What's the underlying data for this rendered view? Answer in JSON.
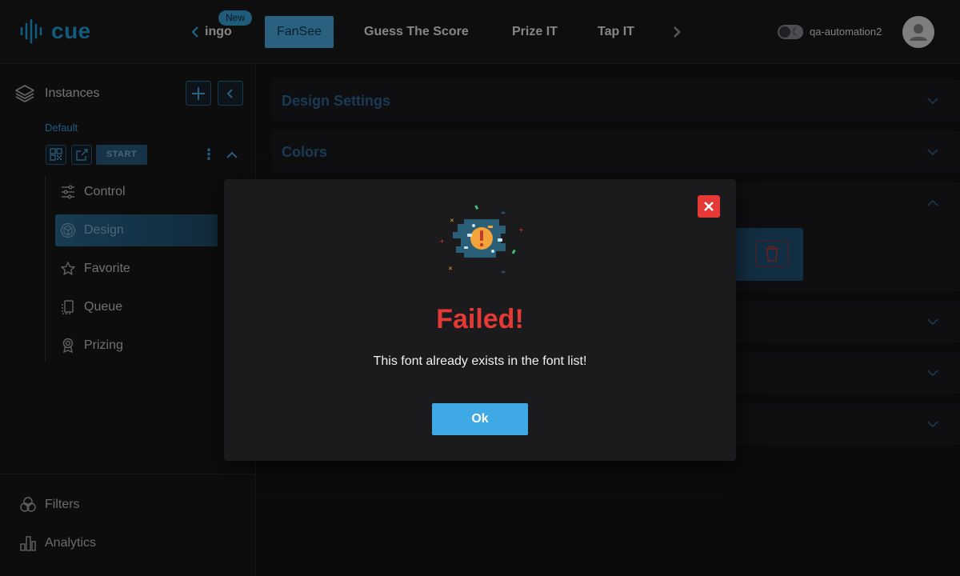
{
  "app": {
    "logo_text": "cue"
  },
  "header": {
    "tabs": [
      {
        "label": "ingo"
      },
      {
        "label": "FanSee",
        "active": true
      },
      {
        "label": "Guess The Score"
      },
      {
        "label": "Prize IT"
      },
      {
        "label": "Tap IT"
      }
    ],
    "new_badge": "New",
    "prev_icon": "chevron-left-icon",
    "next_icon": "chevron-right-icon",
    "theme_toggle_icon": "moon-icon",
    "username": "qa-automation2",
    "avatar_icon": "user-icon"
  },
  "sidebar": {
    "title": "Instances",
    "instance_name": "Default",
    "start_label": "START",
    "menu": [
      {
        "label": "Control",
        "icon": "sliders-icon"
      },
      {
        "label": "Design",
        "icon": "cube-icon",
        "active": true
      },
      {
        "label": "Favorite",
        "icon": "star-icon"
      },
      {
        "label": "Queue",
        "icon": "queue-icon"
      },
      {
        "label": "Prizing",
        "icon": "award-icon"
      }
    ],
    "bottom": [
      {
        "label": "Filters",
        "icon": "filters-icon"
      },
      {
        "label": "Analytics",
        "icon": "analytics-icon"
      }
    ]
  },
  "main": {
    "sections": [
      {
        "title": "Design Settings"
      },
      {
        "title": "Colors"
      }
    ]
  },
  "modal": {
    "title": "Failed!",
    "message": "This font already exists in the font list!",
    "ok_label": "Ok",
    "colors": {
      "title": "#e53935",
      "ok_button": "#3fa9e6",
      "close_button": "#e53935"
    }
  }
}
